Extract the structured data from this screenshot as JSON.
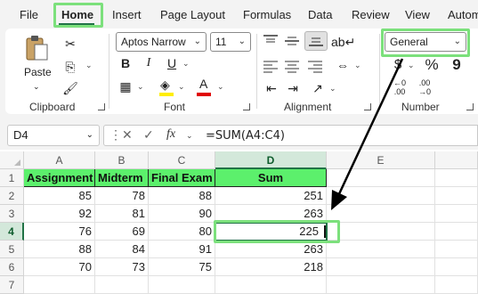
{
  "menu": [
    "File",
    "Home",
    "Insert",
    "Page Layout",
    "Formulas",
    "Data",
    "Review",
    "View",
    "Autom"
  ],
  "ribbon": {
    "clipboard": {
      "label": "Clipboard",
      "paste_label": "Paste"
    },
    "font": {
      "label": "Font",
      "font_name": "Aptos Narrow",
      "font_size": "11",
      "bold": "B",
      "italic": "I",
      "underline": "U",
      "font_color_glyph": "A"
    },
    "alignment": {
      "label": "Alignment"
    },
    "number": {
      "label": "Number",
      "format": "General",
      "currency_glyph": "$",
      "percent_glyph": "%",
      "comma_glyph": "9"
    }
  },
  "formula_bar": {
    "name_box": "D4",
    "formula": "=SUM(A4:C4)",
    "fx": "fx"
  },
  "columns": [
    "A",
    "B",
    "C",
    "D",
    "E"
  ],
  "rows": [
    "1",
    "2",
    "3",
    "4",
    "5",
    "6",
    "7"
  ],
  "table": {
    "headers": [
      "Assignment",
      "Midterm",
      "Final Exam",
      "Sum"
    ],
    "rows": [
      [
        "85",
        "78",
        "88",
        "251"
      ],
      [
        "92",
        "81",
        "90",
        "263"
      ],
      [
        "76",
        "69",
        "80",
        "225"
      ],
      [
        "88",
        "84",
        "91",
        "263"
      ],
      [
        "70",
        "73",
        "75",
        "218"
      ]
    ]
  },
  "colors": {
    "accent": "#217346",
    "highlight": "#7ce07c",
    "header_fill": "#5cf06c"
  },
  "selected_cell": "D4"
}
